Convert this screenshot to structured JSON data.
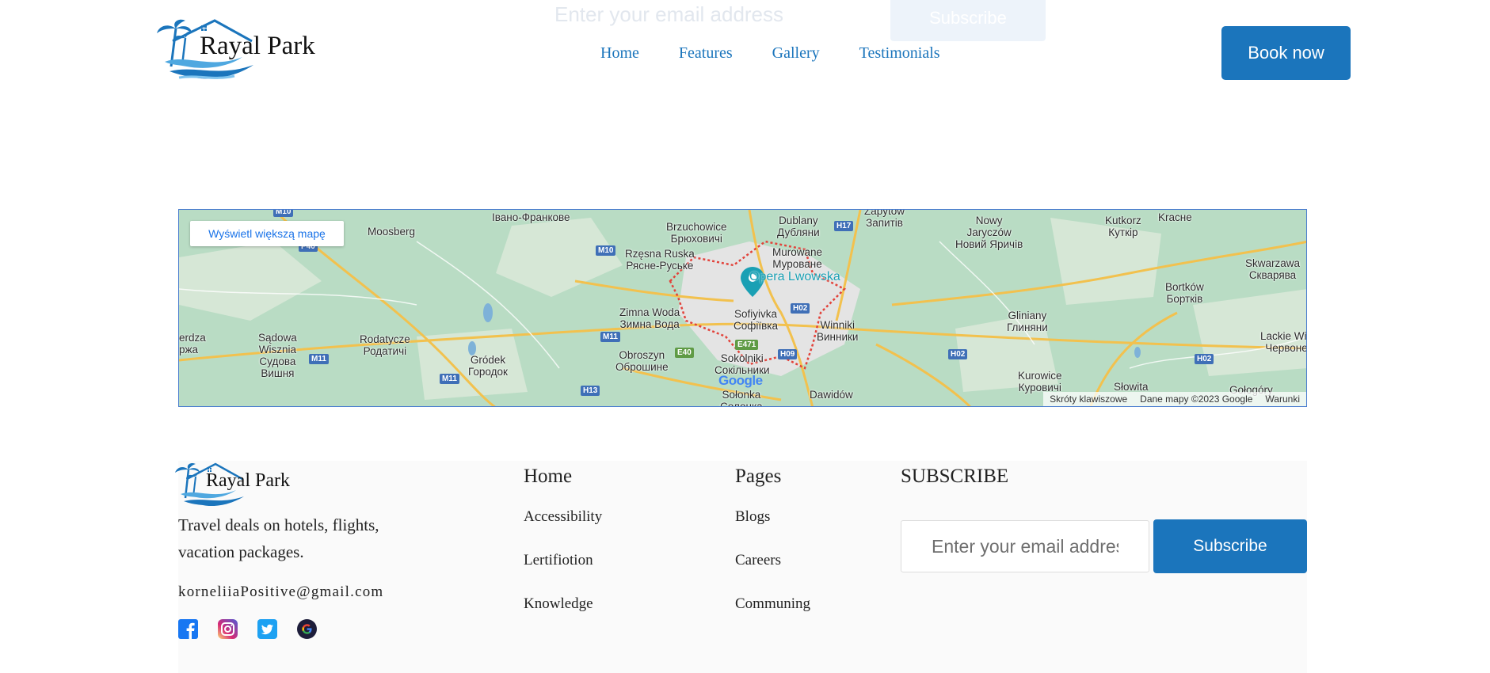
{
  "ghost_subscribe": {
    "email_placeholder": "Enter your email address",
    "button_label": "Subscribe"
  },
  "header": {
    "brand": "Rayal Park",
    "nav": [
      "Home",
      "Features",
      "Gallery",
      "Testimonials"
    ],
    "book_button": "Book now"
  },
  "map": {
    "larger_map_link": "Wyświetl większą mapę",
    "marker_label": "Opera Lwowska",
    "google_logo": "Google",
    "footer": [
      "Skróty klawiszowe",
      "Dane mapy ©2023 Google",
      "Warunki"
    ],
    "places": [
      "Moosberg",
      "Івано-Франкове",
      "Brzuchowice\nБрюховичі",
      "Dublany\nДубляни",
      "Zapytów\nЗапитів",
      "Nowy\nJaryczów\nНовий Яричів",
      "Kutkorz\nКуткір",
      "Krасне",
      "Rzęsna Ruska\nРясне-Руське",
      "Murowane\nМуроване",
      "Skwarzawa\nСкварява",
      "Bortków\nБортків",
      "Zimna Woda\nЗимна Вода",
      "Sofiyivka\nСофіївка",
      "Winniki\nВинники",
      "Gliniany\nГлиняни",
      "Sądowa\nWisznia\nСудова\nВишня",
      "Rodatycze\nРодатичі",
      "Gródek\nГородок",
      "Obroszyn\nОброшине",
      "Sokolniki\nСокільники",
      "Kurowice\nКуровичі",
      "Słowita",
      "Lackie Wie\nЧервоне",
      "Sołonka\nСолонка",
      "Dawidów",
      "Gołogóry",
      "erdza\nржа"
    ],
    "roads": [
      "M10",
      "P40",
      "M10",
      "H17",
      "H02",
      "M11",
      "M11",
      "M11",
      "E40",
      "E471",
      "H09",
      "H13",
      "H02",
      "H02"
    ]
  },
  "footer": {
    "brand": "Rayal Park",
    "tagline": "Travel deals on hotels, flights, vacation packages.",
    "email": "korneliiaPositive@gmail.com",
    "social": [
      "facebook-icon",
      "instagram-icon",
      "twitter-icon",
      "google-icon"
    ],
    "col_home": {
      "title": "Home",
      "links": [
        "Accessibility",
        "Lertifiotion",
        "Knowledge"
      ]
    },
    "col_pages": {
      "title": "Pages",
      "links": [
        "Blogs",
        "Careers",
        "Communing"
      ]
    },
    "subscribe": {
      "title": "SUBSCRIBE",
      "email_placeholder": "Enter your email address",
      "button_label": "Subscribe"
    }
  },
  "colors": {
    "accent": "#1b75bc",
    "map_land": "#b9dcc4",
    "map_border": "#4a7dcf"
  }
}
